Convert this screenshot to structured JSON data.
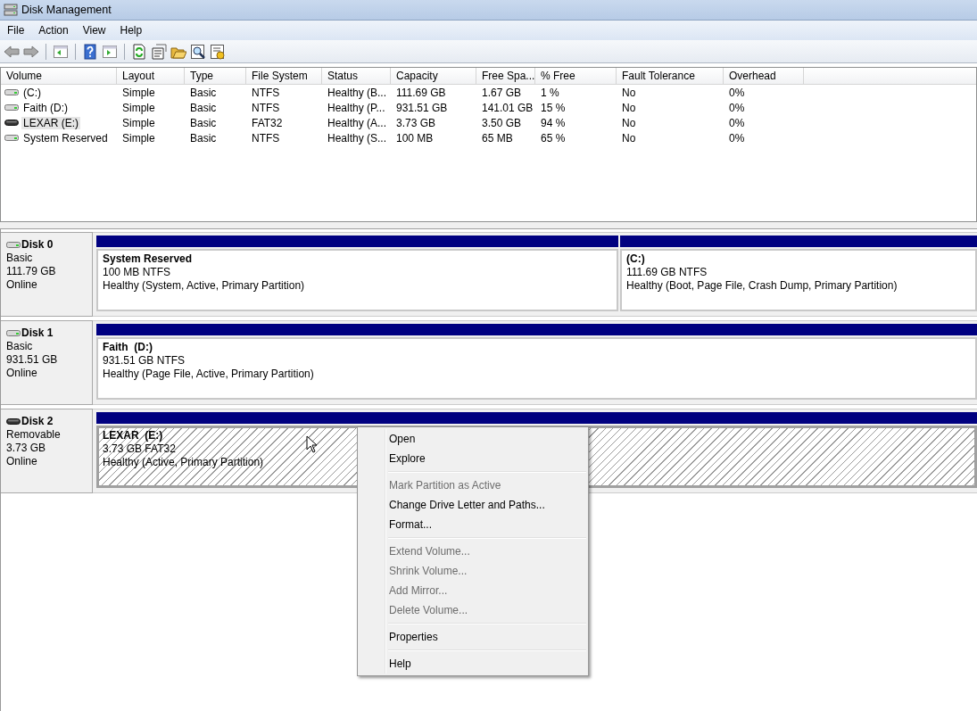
{
  "window": {
    "title": "Disk Management"
  },
  "menu_bar": [
    "File",
    "Action",
    "View",
    "Help"
  ],
  "volumes": {
    "columns": [
      "Volume",
      "Layout",
      "Type",
      "File System",
      "Status",
      "Capacity",
      "Free Spa...",
      "% Free",
      "Fault Tolerance",
      "Overhead"
    ],
    "rows": [
      {
        "kind": "fixed",
        "selected": false,
        "cells": [
          "(C:)",
          "Simple",
          "Basic",
          "NTFS",
          "Healthy (B...",
          "111.69 GB",
          "1.67 GB",
          "1 %",
          "No",
          "0%"
        ]
      },
      {
        "kind": "fixed",
        "selected": false,
        "cells": [
          "Faith (D:)",
          "Simple",
          "Basic",
          "NTFS",
          "Healthy (P...",
          "931.51 GB",
          "141.01 GB",
          "15 %",
          "No",
          "0%"
        ]
      },
      {
        "kind": "removable",
        "selected": true,
        "cells": [
          "LEXAR (E:)",
          "Simple",
          "Basic",
          "FAT32",
          "Healthy (A...",
          "3.73 GB",
          "3.50 GB",
          "94 %",
          "No",
          "0%"
        ]
      },
      {
        "kind": "fixed",
        "selected": false,
        "cells": [
          "System Reserved",
          "Simple",
          "Basic",
          "NTFS",
          "Healthy (S...",
          "100 MB",
          "65 MB",
          "65 %",
          "No",
          "0%"
        ]
      }
    ]
  },
  "disks": [
    {
      "name": "Disk 0",
      "kind": "fixed",
      "type": "Basic",
      "size": "111.79 GB",
      "status": "Online",
      "partitions": [
        {
          "name": "System Reserved",
          "size": "100 MB NTFS",
          "status": "Healthy (System, Active, Primary Partition)",
          "selected": false
        },
        {
          "name": "(C:)",
          "size": "111.69 GB NTFS",
          "status": "Healthy (Boot, Page File, Crash Dump, Primary Partition)",
          "selected": false
        }
      ]
    },
    {
      "name": "Disk 1",
      "kind": "fixed",
      "type": "Basic",
      "size": "931.51 GB",
      "status": "Online",
      "partitions": [
        {
          "name": "Faith  (D:)",
          "size": "931.51 GB NTFS",
          "status": "Healthy (Page File, Active, Primary Partition)",
          "selected": false
        }
      ]
    },
    {
      "name": "Disk 2",
      "kind": "removable",
      "type": "Removable",
      "size": "3.73 GB",
      "status": "Online",
      "partitions": [
        {
          "name": "LEXAR  (E:)",
          "size": "3.73 GB FAT32",
          "status": "Healthy (Active, Primary Partition)",
          "selected": true
        }
      ]
    }
  ],
  "context_menu": {
    "groups": [
      [
        {
          "label": "Open",
          "disabled": false
        },
        {
          "label": "Explore",
          "disabled": false
        }
      ],
      [
        {
          "label": "Mark Partition as Active",
          "disabled": true
        },
        {
          "label": "Change Drive Letter and Paths...",
          "disabled": false
        },
        {
          "label": "Format...",
          "disabled": false
        }
      ],
      [
        {
          "label": "Extend Volume...",
          "disabled": true
        },
        {
          "label": "Shrink Volume...",
          "disabled": true
        },
        {
          "label": "Add Mirror...",
          "disabled": true
        },
        {
          "label": "Delete Volume...",
          "disabled": true
        }
      ],
      [
        {
          "label": "Properties",
          "disabled": false
        }
      ],
      [
        {
          "label": "Help",
          "disabled": false
        }
      ]
    ]
  }
}
